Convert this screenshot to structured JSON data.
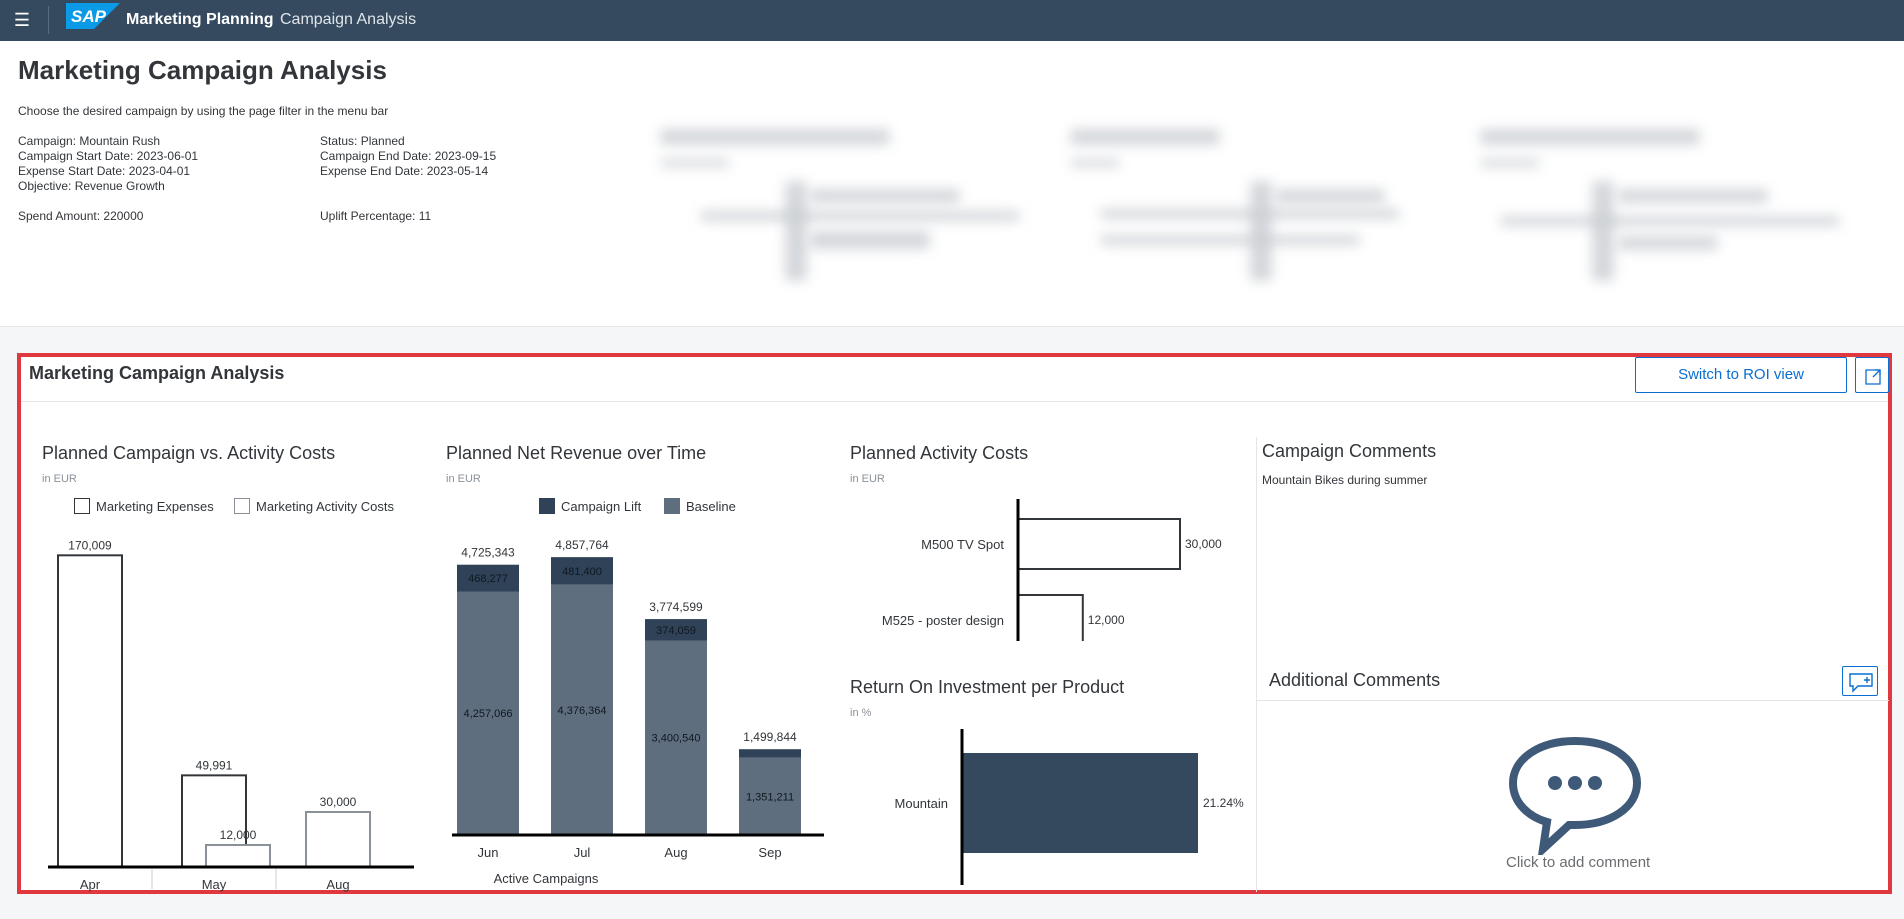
{
  "shell": {
    "app_name": "Marketing Planning",
    "page_name": "Campaign Analysis",
    "logo_text": "SAP"
  },
  "header": {
    "title": "Marketing Campaign Analysis",
    "subtitle": "Choose the desired campaign by using the page filter in the menu bar",
    "info_left": [
      "Campaign: Mountain Rush",
      "Campaign Start Date: 2023-06-01",
      "Expense Start Date: 2023-04-01",
      "Objective: Revenue Growth"
    ],
    "info_right": [
      "Status: Planned",
      "Campaign End Date: 2023-09-15",
      "Expense End Date: 2023-05-14"
    ],
    "spend": "Spend Amount: 220000",
    "uplift": "Uplift Percentage: 11"
  },
  "panel": {
    "title": "Marketing Campaign Analysis",
    "roi_button": "Switch to ROI view"
  },
  "colors": {
    "shell": "#354a5f",
    "accent": "#0a6ed1",
    "campaign_lift": "#2f4258",
    "baseline": "#5f6e7e",
    "roi_bar": "#34495e",
    "highlight": "#e0383e"
  },
  "chart_data": [
    {
      "type": "bar",
      "title": "Planned Campaign vs. Activity Costs",
      "unit": "in EUR",
      "categories": [
        "Apr",
        "May",
        "Aug"
      ],
      "series": [
        {
          "name": "Marketing Expenses",
          "values": [
            170009,
            49991,
            null
          ]
        },
        {
          "name": "Marketing Activity Costs",
          "values": [
            null,
            12000,
            30000
          ]
        }
      ],
      "labels": [
        "170,009",
        "49,991",
        "12,000",
        "30,000"
      ],
      "ylim": [
        0,
        180000
      ]
    },
    {
      "type": "bar",
      "title": "Planned Net Revenue over Time",
      "unit": "in EUR",
      "xlabel": "Active Campaigns",
      "categories": [
        "Jun",
        "Jul",
        "Aug",
        "Sep"
      ],
      "series": [
        {
          "name": "Campaign Lift",
          "values": [
            468277,
            481400,
            374059,
            148633
          ]
        },
        {
          "name": "Baseline",
          "values": [
            4257066,
            4376364,
            3400540,
            1351211
          ]
        }
      ],
      "totals": [
        4725343,
        4857764,
        3774599,
        1499844
      ],
      "total_labels": [
        "4,725,343",
        "4,857,764",
        "3,774,599",
        "1,499,844"
      ],
      "lift_labels": [
        "468,277",
        "481,400",
        "374,059",
        ""
      ],
      "base_labels": [
        "4,257,066",
        "4,376,364",
        "3,400,540",
        "1,351,211"
      ],
      "ylim": [
        0,
        5000000
      ]
    },
    {
      "type": "bar",
      "title": "Planned Activity Costs",
      "unit": "in EUR",
      "orientation": "horizontal",
      "categories": [
        "M500 TV Spot",
        "M525 - poster design"
      ],
      "values": [
        30000,
        12000
      ],
      "labels": [
        "30,000",
        "12,000"
      ]
    },
    {
      "type": "bar",
      "title": "Return On Investment per Product",
      "unit": "in %",
      "orientation": "horizontal",
      "categories": [
        "Mountain"
      ],
      "values": [
        21.24
      ],
      "labels": [
        "21.24%"
      ]
    }
  ],
  "comments": {
    "campaign_title": "Campaign Comments",
    "campaign_text": "Mountain Bikes during summer",
    "additional_title": "Additional Comments",
    "click_to_add": "Click to add comment"
  }
}
